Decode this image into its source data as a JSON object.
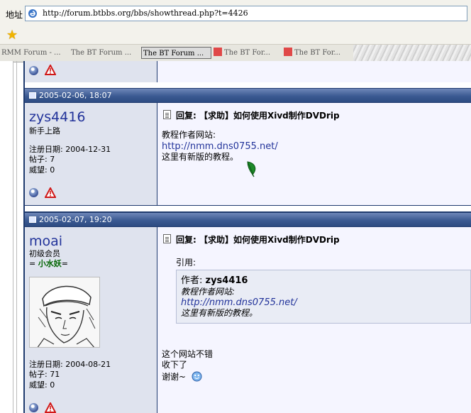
{
  "browser": {
    "address_label": "地址",
    "url": "http://forum.btbbs.org/bbs/showthread.php?t=4426",
    "tabs": [
      {
        "label": "RMM Forum - ..."
      },
      {
        "label": "The BT Forum ..."
      },
      {
        "label": "The BT Forum ..."
      },
      {
        "label": "The BT For..."
      },
      {
        "label": "The BT For..."
      }
    ],
    "active_tab_index": 2
  },
  "posts": [
    {
      "date": "2005-02-06, 18:07",
      "username": "zys4416",
      "rank": "新手上路",
      "join_label": "注册日期: 2004-12-31",
      "posts_label": "帖子: 7",
      "rep_label": "威望: 0",
      "title": "回复: 【求助】如何使用Xivd制作DVDrip",
      "lines": [
        "教程作者网站:",
        "http://nmm.dns0755.net/",
        "这里有新版的教程。"
      ]
    },
    {
      "date": "2005-02-07, 19:20",
      "username": "moai",
      "rank": "初级会员",
      "tag_prefix": "= ",
      "tag": "小水妖",
      "tag_suffix": "=",
      "join_label": "注册日期: 2004-08-21",
      "posts_label": "帖子: 71",
      "rep_label": "威望: 0",
      "title": "回复: 【求助】如何使用Xivd制作DVDrip",
      "quote_label": "引用:",
      "quote_author_prefix": "作者: ",
      "quote_author": "zys4416",
      "quote_lines": [
        "教程作者网站:",
        "http://nmm.dns0755.net/",
        "这里有新版的教程。"
      ],
      "lines": [
        "这个网站不错",
        "收下了",
        "谢谢~"
      ]
    }
  ],
  "colors": {
    "header_bar": "#2d4b82",
    "username": "#22339a",
    "tag_green": "#006400"
  }
}
